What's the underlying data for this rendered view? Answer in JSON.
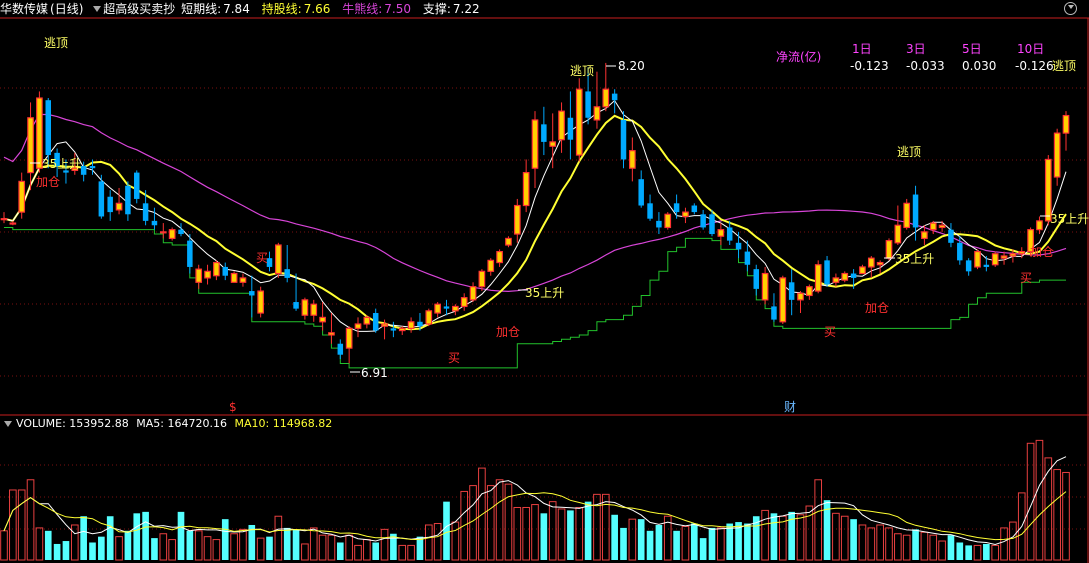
{
  "header": {
    "stock_name": "华数传媒",
    "period": "(日线)",
    "indicator_name": "超高级买卖抄",
    "short_label": "短期线:",
    "short_value": "7.84",
    "hold_label": "持股线:",
    "hold_value": "7.66",
    "bull_label": "牛熊线:",
    "bull_value": "7.50",
    "support_label": "支撑:",
    "support_value": "7.22"
  },
  "net_flow": {
    "title": "净流(亿)",
    "periods": [
      "1日",
      "3日",
      "5日",
      "10日"
    ],
    "values": [
      "-0.123",
      "-0.033",
      "0.030",
      "-0.126"
    ]
  },
  "volume_header": {
    "volume_label": "VOLUME:",
    "volume_value": "153952.88",
    "ma5_label": "MA5:",
    "ma5_value": "164720.16",
    "ma10_label": "MA10:",
    "ma10_value": "114968.82"
  },
  "colors": {
    "background": "#000000",
    "up": "#ff3232",
    "down": "#00aaff",
    "signal_fill": "#ffd000",
    "short_line": "#ffffff",
    "hold_line": "#ffff33",
    "bull_line": "#d845d8",
    "support_line": "#22c22c",
    "vol_up": "#e84040",
    "vol_down": "#55ffff",
    "divider": "#c81e1e"
  },
  "chart_data": {
    "type": "candlestick",
    "price_range": [
      6.7,
      8.35
    ],
    "candles": [
      [
        7.49,
        7.52,
        7.47,
        7.49
      ],
      [
        7.47,
        7.48,
        7.46,
        7.47
      ],
      [
        7.52,
        7.7,
        7.49,
        7.66
      ],
      [
        7.7,
        8.02,
        7.62,
        7.95
      ],
      [
        7.72,
        8.07,
        7.7,
        8.04
      ],
      [
        8.03,
        8.04,
        7.72,
        7.78
      ],
      [
        7.79,
        7.81,
        7.68,
        7.73
      ],
      [
        7.71,
        7.76,
        7.65,
        7.7
      ],
      [
        7.71,
        7.79,
        7.69,
        7.72
      ],
      [
        7.73,
        7.75,
        7.66,
        7.69
      ],
      [
        7.73,
        7.76,
        7.69,
        7.72
      ],
      [
        7.66,
        7.69,
        7.49,
        7.5
      ],
      [
        7.59,
        7.62,
        7.48,
        7.52
      ],
      [
        7.53,
        7.63,
        7.51,
        7.56
      ],
      [
        7.64,
        7.66,
        7.48,
        7.51
      ],
      [
        7.7,
        7.71,
        7.56,
        7.58
      ],
      [
        7.56,
        7.62,
        7.46,
        7.48
      ],
      [
        7.48,
        7.54,
        7.44,
        7.46
      ],
      [
        7.43,
        7.47,
        7.4,
        7.43
      ],
      [
        7.4,
        7.45,
        7.39,
        7.44
      ],
      [
        7.44,
        7.47,
        7.41,
        7.42
      ],
      [
        7.39,
        7.42,
        7.24,
        7.27
      ],
      [
        7.2,
        7.28,
        7.17,
        7.26
      ],
      [
        7.22,
        7.28,
        7.19,
        7.25
      ],
      [
        7.23,
        7.3,
        7.21,
        7.29
      ],
      [
        7.27,
        7.29,
        7.21,
        7.23
      ],
      [
        7.2,
        7.25,
        7.2,
        7.24
      ],
      [
        7.2,
        7.24,
        7.18,
        7.22
      ],
      [
        7.16,
        7.23,
        7.04,
        7.14
      ],
      [
        7.06,
        7.18,
        7.04,
        7.16
      ],
      [
        7.31,
        7.34,
        7.25,
        7.27
      ],
      [
        7.24,
        7.38,
        7.22,
        7.37
      ],
      [
        7.26,
        7.37,
        7.2,
        7.22
      ],
      [
        7.11,
        7.24,
        7.07,
        7.08
      ],
      [
        7.05,
        7.13,
        7.03,
        7.12
      ],
      [
        7.05,
        7.12,
        7.02,
        7.1
      ],
      [
        7.02,
        7.11,
        6.98,
        7.04
      ],
      [
        6.96,
        7.06,
        6.92,
        6.97
      ],
      [
        6.92,
        6.94,
        6.85,
        6.87
      ],
      [
        6.9,
        7.0,
        6.83,
        6.99
      ],
      [
        6.99,
        7.04,
        6.95,
        7.01
      ],
      [
        7.01,
        7.05,
        6.99,
        7.04
      ],
      [
        7.06,
        7.08,
        6.97,
        6.98
      ],
      [
        7.0,
        7.03,
        6.94,
        7.01
      ],
      [
        6.99,
        7.02,
        6.95,
        6.98
      ],
      [
        6.98,
        7.0,
        6.96,
        6.99
      ],
      [
        6.99,
        7.04,
        6.97,
        7.02
      ],
      [
        7.02,
        7.06,
        6.98,
        7.0
      ],
      [
        7.01,
        7.08,
        7.0,
        7.07
      ],
      [
        7.06,
        7.11,
        7.04,
        7.1
      ],
      [
        7.09,
        7.12,
        7.05,
        7.08
      ],
      [
        7.07,
        7.1,
        7.05,
        7.09
      ],
      [
        7.09,
        7.15,
        7.07,
        7.13
      ],
      [
        7.12,
        7.2,
        7.11,
        7.18
      ],
      [
        7.18,
        7.26,
        7.16,
        7.25
      ],
      [
        7.25,
        7.31,
        7.23,
        7.3
      ],
      [
        7.29,
        7.35,
        7.27,
        7.34
      ],
      [
        7.37,
        7.41,
        7.36,
        7.4
      ],
      [
        7.42,
        7.58,
        7.38,
        7.55
      ],
      [
        7.55,
        7.76,
        7.52,
        7.7
      ],
      [
        7.72,
        7.98,
        7.63,
        7.94
      ],
      [
        7.92,
        8.0,
        7.78,
        7.84
      ],
      [
        7.82,
        7.97,
        7.72,
        7.84
      ],
      [
        7.85,
        8.02,
        7.79,
        7.98
      ],
      [
        7.95,
        8.07,
        7.76,
        7.85
      ],
      [
        7.78,
        8.13,
        7.75,
        8.08
      ],
      [
        8.07,
        8.18,
        7.92,
        7.95
      ],
      [
        7.94,
        8.16,
        7.9,
        8.0
      ],
      [
        8.0,
        8.2,
        7.98,
        8.08
      ],
      [
        8.06,
        8.08,
        7.97,
        8.03
      ],
      [
        7.94,
        7.98,
        7.72,
        7.76
      ],
      [
        7.72,
        7.86,
        7.66,
        7.8
      ],
      [
        7.67,
        7.71,
        7.54,
        7.55
      ],
      [
        7.56,
        7.6,
        7.48,
        7.49
      ],
      [
        7.48,
        7.52,
        7.42,
        7.45
      ],
      [
        7.45,
        7.52,
        7.44,
        7.51
      ],
      [
        7.56,
        7.6,
        7.49,
        7.52
      ],
      [
        7.5,
        7.54,
        7.47,
        7.52
      ],
      [
        7.55,
        7.56,
        7.51,
        7.52
      ],
      [
        7.51,
        7.53,
        7.44,
        7.45
      ],
      [
        7.51,
        7.53,
        7.41,
        7.42
      ],
      [
        7.41,
        7.47,
        7.37,
        7.44
      ],
      [
        7.45,
        7.48,
        7.37,
        7.39
      ],
      [
        7.38,
        7.43,
        7.31,
        7.35
      ],
      [
        7.34,
        7.39,
        7.25,
        7.28
      ],
      [
        7.26,
        7.28,
        7.14,
        7.17
      ],
      [
        7.12,
        7.27,
        7.1,
        7.24
      ],
      [
        7.09,
        7.15,
        7.02,
        7.03
      ],
      [
        7.02,
        7.23,
        7.01,
        7.22
      ],
      [
        7.2,
        7.26,
        7.05,
        7.12
      ],
      [
        7.12,
        7.16,
        7.06,
        7.15
      ],
      [
        7.14,
        7.19,
        7.12,
        7.18
      ],
      [
        7.16,
        7.3,
        7.15,
        7.28
      ],
      [
        7.3,
        7.32,
        7.18,
        7.19
      ],
      [
        7.2,
        7.24,
        7.18,
        7.22
      ],
      [
        7.21,
        7.25,
        7.2,
        7.24
      ],
      [
        7.24,
        7.26,
        7.17,
        7.22
      ],
      [
        7.24,
        7.28,
        7.24,
        7.27
      ],
      [
        7.27,
        7.32,
        7.22,
        7.31
      ],
      [
        7.28,
        7.3,
        7.24,
        7.29
      ],
      [
        7.31,
        7.4,
        7.3,
        7.39
      ],
      [
        7.38,
        7.55,
        7.37,
        7.46
      ],
      [
        7.45,
        7.58,
        7.44,
        7.56
      ],
      [
        7.6,
        7.64,
        7.39,
        7.45
      ],
      [
        7.4,
        7.46,
        7.37,
        7.43
      ],
      [
        7.44,
        7.48,
        7.42,
        7.47
      ],
      [
        7.45,
        7.48,
        7.43,
        7.46
      ],
      [
        7.44,
        7.47,
        7.36,
        7.38
      ],
      [
        7.38,
        7.41,
        7.28,
        7.3
      ],
      [
        7.3,
        7.31,
        7.23,
        7.25
      ],
      [
        7.27,
        7.35,
        7.26,
        7.34
      ],
      [
        7.28,
        7.32,
        7.25,
        7.27
      ],
      [
        7.28,
        7.34,
        7.27,
        7.33
      ],
      [
        7.31,
        7.34,
        7.28,
        7.32
      ],
      [
        7.32,
        7.35,
        7.29,
        7.33
      ],
      [
        7.33,
        7.36,
        7.31,
        7.34
      ],
      [
        7.34,
        7.45,
        7.32,
        7.44
      ],
      [
        7.44,
        7.5,
        7.42,
        7.48
      ],
      [
        7.48,
        7.78,
        7.46,
        7.76
      ],
      [
        7.68,
        7.9,
        7.64,
        7.88
      ],
      [
        7.88,
        7.98,
        7.8,
        7.96
      ]
    ],
    "volume": [
      20,
      48,
      48,
      55,
      22,
      20,
      11,
      13,
      24,
      30,
      12,
      16,
      30,
      16,
      20,
      32,
      33,
      15,
      18,
      14,
      33,
      20,
      20,
      16,
      14,
      28,
      18,
      21,
      24,
      15,
      16,
      30,
      22,
      21,
      11,
      22,
      17,
      17,
      12,
      17,
      10,
      14,
      12,
      21,
      18,
      10,
      10,
      16,
      24,
      25,
      40,
      26,
      47,
      51,
      63,
      51,
      55,
      52,
      36,
      36,
      38,
      32,
      40,
      35,
      34,
      36,
      40,
      45,
      45,
      31,
      22,
      28,
      28,
      20,
      24,
      30,
      20,
      23,
      25,
      15,
      22,
      22,
      25,
      26,
      25,
      30,
      34,
      32,
      30,
      33,
      31,
      37,
      55,
      41,
      32,
      30,
      28,
      24,
      22,
      24,
      22,
      18,
      17,
      21,
      19,
      17,
      13,
      17,
      12,
      10,
      10,
      11,
      10,
      22,
      26,
      46,
      80,
      82,
      70,
      62,
      60
    ],
    "labels": {
      "escape": "逃顶",
      "add": "加仓",
      "buy": "买",
      "rise35": "35上升",
      "high_mark": "8.20",
      "low_mark": "6.91",
      "marker_s": "$",
      "marker_cai": "财"
    }
  }
}
